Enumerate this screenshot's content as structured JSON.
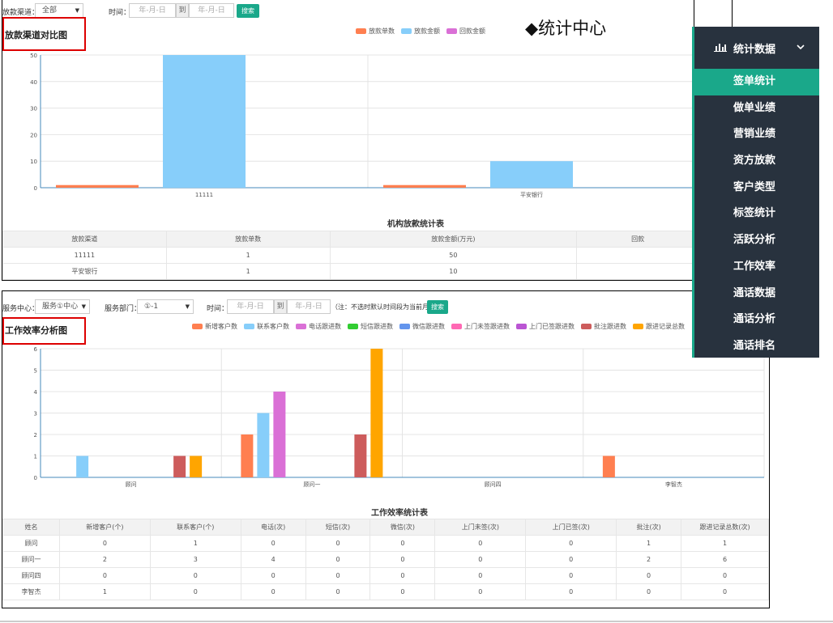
{
  "heading": "◆统计中心",
  "sidebar": {
    "title": "统计数据",
    "items": [
      {
        "label": "签单统计",
        "active": true
      },
      {
        "label": "做单业绩"
      },
      {
        "label": "营销业绩"
      },
      {
        "label": "资方放款"
      },
      {
        "label": "客户类型"
      },
      {
        "label": "标签统计"
      },
      {
        "label": "活跃分析"
      },
      {
        "label": "工作效率"
      },
      {
        "label": "通话数据"
      },
      {
        "label": "通话分析"
      },
      {
        "label": "通话排名"
      }
    ]
  },
  "panel1": {
    "filter_channel_label": "放款渠道：",
    "filter_channel_value": "全部",
    "time_label": "时间：",
    "date_placeholder": "年-月-日",
    "date_to": "到",
    "search_label": "搜索",
    "title": "放款渠道对比图",
    "legend": [
      {
        "name": "放款单数",
        "color": "#ff7f50"
      },
      {
        "name": "放款金额",
        "color": "#87cefa"
      },
      {
        "name": "回款金额",
        "color": "#da70d6"
      }
    ],
    "table_title": "机构放款统计表",
    "table_headers": [
      "放款渠道",
      "放款单数",
      "放款金额(万元)",
      "回款"
    ],
    "table_rows": [
      [
        "11111",
        "1",
        "50",
        ""
      ],
      [
        "平安银行",
        "1",
        "10",
        ""
      ]
    ]
  },
  "panel2": {
    "center_label": "服务中心：",
    "center_value": "服务①中心",
    "dept_label": "服务部门：",
    "dept_value": "①-1",
    "time_label": "时间：",
    "date_placeholder": "年-月-日",
    "date_to": "到",
    "note": "（注：不选时默认时间段为当前月）",
    "search_label": "搜索",
    "title": "工作效率分析图",
    "legend": [
      {
        "name": "新增客户数",
        "color": "#ff7f50"
      },
      {
        "name": "联系客户数",
        "color": "#87cefa"
      },
      {
        "name": "电话跟进数",
        "color": "#da70d6"
      },
      {
        "name": "短信跟进数",
        "color": "#32cd32"
      },
      {
        "name": "微信跟进数",
        "color": "#6495ed"
      },
      {
        "name": "上门未签跟进数",
        "color": "#ff69b4"
      },
      {
        "name": "上门已签跟进数",
        "color": "#ba55d3"
      },
      {
        "name": "批注跟进数",
        "color": "#cd5c5c"
      },
      {
        "name": "跟进记录总数",
        "color": "#ffa500"
      }
    ],
    "table_title": "工作效率统计表",
    "table_headers": [
      "姓名",
      "新增客户(个)",
      "联系客户(个)",
      "电话(次)",
      "短信(次)",
      "微信(次)",
      "上门未签(次)",
      "上门已签(次)",
      "批注(次)",
      "跟进记录总数(次)"
    ],
    "table_rows": [
      [
        "顾问",
        "0",
        "1",
        "0",
        "0",
        "0",
        "0",
        "0",
        "1",
        "1"
      ],
      [
        "顾问一",
        "2",
        "3",
        "4",
        "0",
        "0",
        "0",
        "0",
        "2",
        "6"
      ],
      [
        "顾问四",
        "0",
        "0",
        "0",
        "0",
        "0",
        "0",
        "0",
        "0",
        "0"
      ],
      [
        "李智杰",
        "1",
        "0",
        "0",
        "0",
        "0",
        "0",
        "0",
        "0",
        "0"
      ]
    ]
  },
  "chart_data": [
    {
      "type": "bar",
      "title": "放款渠道对比图",
      "categories": [
        "11111",
        "平安银行"
      ],
      "series": [
        {
          "name": "放款单数",
          "values": [
            1,
            1
          ],
          "color": "#ff7f50"
        },
        {
          "name": "放款金额",
          "values": [
            50,
            10
          ],
          "color": "#87cefa"
        },
        {
          "name": "回款金额",
          "values": [
            0,
            0
          ],
          "color": "#da70d6"
        }
      ],
      "ylim": [
        0,
        50
      ],
      "yticks": [
        0,
        10,
        20,
        30,
        40,
        50
      ],
      "grid": true,
      "legend": "top-center"
    },
    {
      "type": "bar",
      "title": "工作效率分析图",
      "categories": [
        "顾问",
        "顾问一",
        "顾问四",
        "李智杰"
      ],
      "series": [
        {
          "name": "新增客户数",
          "values": [
            0,
            2,
            0,
            1
          ],
          "color": "#ff7f50"
        },
        {
          "name": "联系客户数",
          "values": [
            1,
            3,
            0,
            0
          ],
          "color": "#87cefa"
        },
        {
          "name": "电话跟进数",
          "values": [
            0,
            4,
            0,
            0
          ],
          "color": "#da70d6"
        },
        {
          "name": "短信跟进数",
          "values": [
            0,
            0,
            0,
            0
          ],
          "color": "#32cd32"
        },
        {
          "name": "微信跟进数",
          "values": [
            0,
            0,
            0,
            0
          ],
          "color": "#6495ed"
        },
        {
          "name": "上门未签跟进数",
          "values": [
            0,
            0,
            0,
            0
          ],
          "color": "#ff69b4"
        },
        {
          "name": "上门已签跟进数",
          "values": [
            0,
            0,
            0,
            0
          ],
          "color": "#ba55d3"
        },
        {
          "name": "批注跟进数",
          "values": [
            1,
            2,
            0,
            0
          ],
          "color": "#cd5c5c"
        },
        {
          "name": "跟进记录总数",
          "values": [
            1,
            6,
            0,
            0
          ],
          "color": "#ffa500"
        }
      ],
      "ylim": [
        0,
        6
      ],
      "yticks": [
        0,
        1,
        2,
        3,
        4,
        5,
        6
      ],
      "grid": true,
      "legend": "top-center"
    }
  ]
}
